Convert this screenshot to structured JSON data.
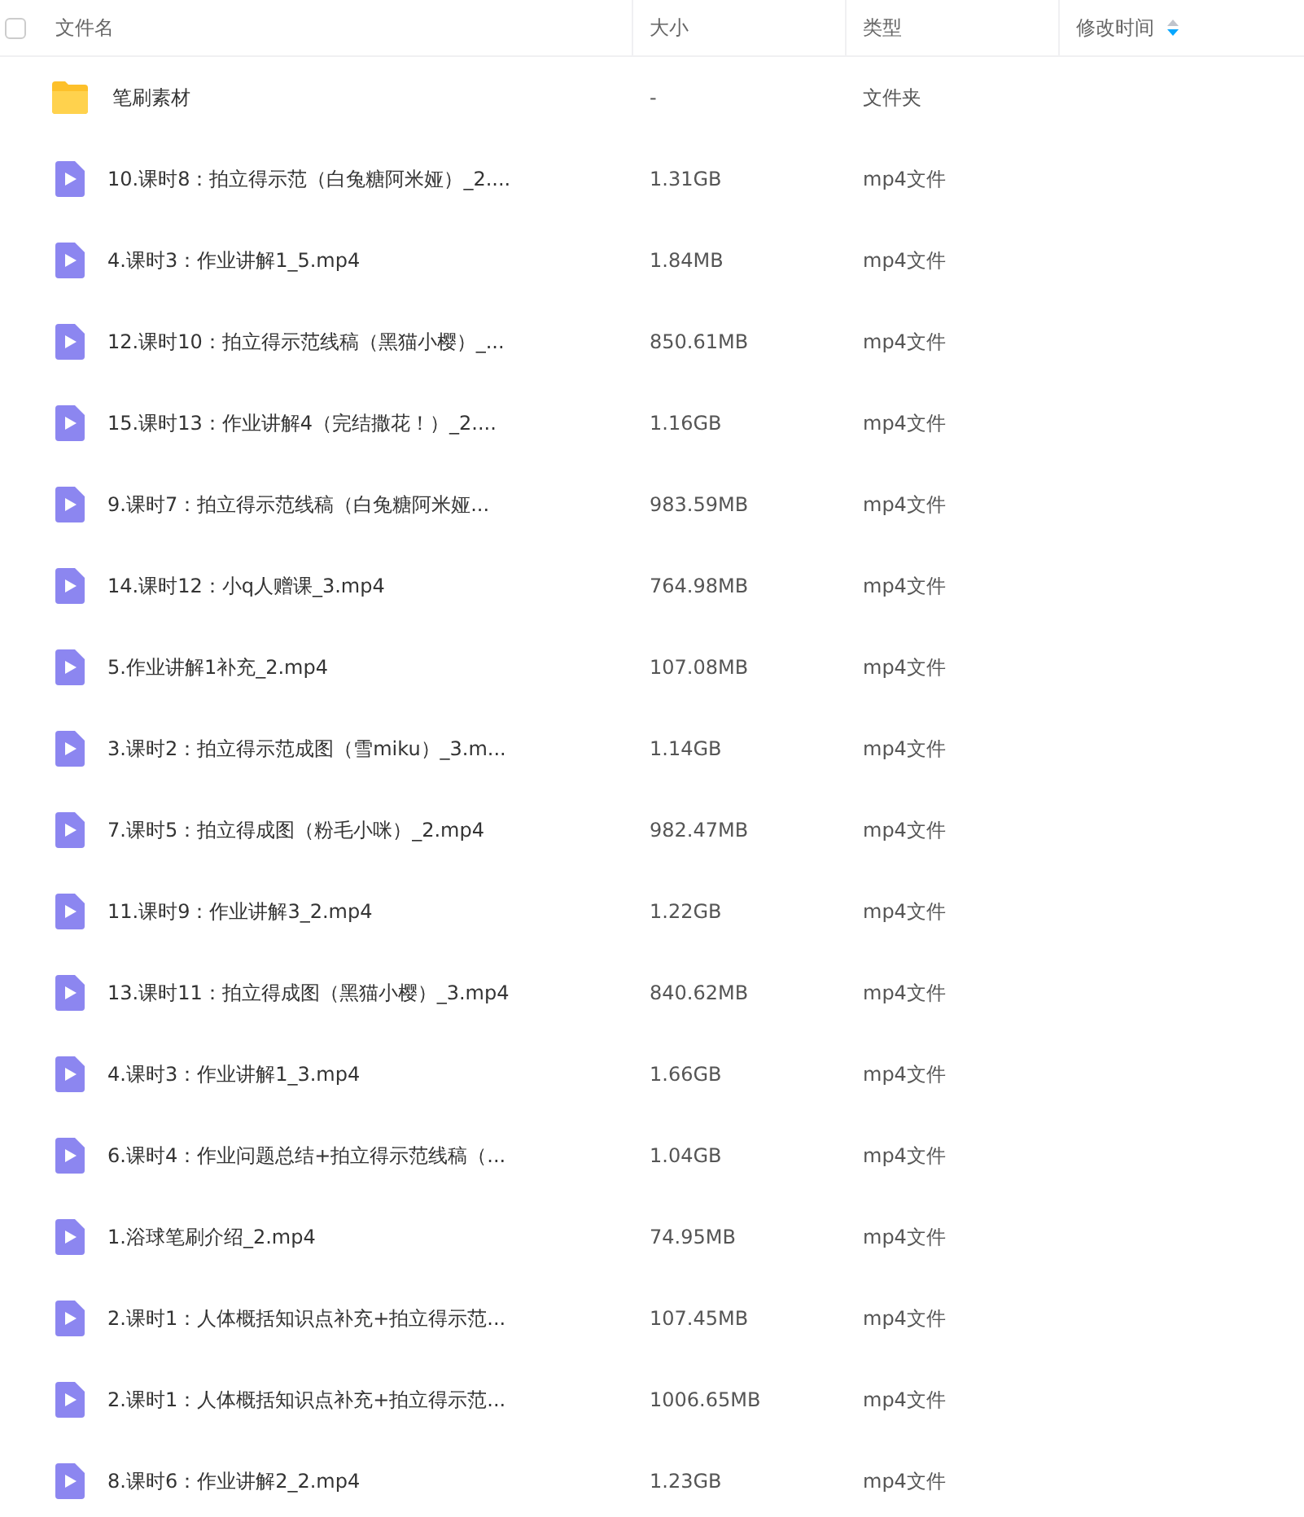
{
  "table": {
    "select_all": {
      "checked": false
    },
    "columns": [
      {
        "label": "文件名"
      },
      {
        "label": "大小"
      },
      {
        "label": "类型"
      },
      {
        "label": "修改时间",
        "sort_descending": true
      }
    ],
    "rows": [
      {
        "kind": "folder",
        "name": "笔刷素材",
        "size": "-",
        "type": "文件夹"
      },
      {
        "kind": "video",
        "name": "10.课时8：拍立得示范（白兔糖阿米娅）_2....",
        "size": "1.31GB",
        "type": "mp4文件"
      },
      {
        "kind": "video",
        "name": "4.课时3：作业讲解1_5.mp4",
        "size": "1.84MB",
        "type": "mp4文件"
      },
      {
        "kind": "video",
        "name": "12.课时10：拍立得示范线稿（黑猫小樱）_...",
        "size": "850.61MB",
        "type": "mp4文件"
      },
      {
        "kind": "video",
        "name": "15.课时13：作业讲解4（完结撒花！）_2....",
        "size": "1.16GB",
        "type": "mp4文件"
      },
      {
        "kind": "video",
        "name": "9.课时7：拍立得示范线稿（白兔糖阿米娅...",
        "size": "983.59MB",
        "type": "mp4文件"
      },
      {
        "kind": "video",
        "name": "14.课时12：小q人赠课_3.mp4",
        "size": "764.98MB",
        "type": "mp4文件"
      },
      {
        "kind": "video",
        "name": "5.作业讲解1补充_2.mp4",
        "size": "107.08MB",
        "type": "mp4文件"
      },
      {
        "kind": "video",
        "name": "3.课时2：拍立得示范成图（雪miku）_3.m...",
        "size": "1.14GB",
        "type": "mp4文件"
      },
      {
        "kind": "video",
        "name": "7.课时5：拍立得成图（粉毛小咪）_2.mp4",
        "size": "982.47MB",
        "type": "mp4文件"
      },
      {
        "kind": "video",
        "name": "11.课时9：作业讲解3_2.mp4",
        "size": "1.22GB",
        "type": "mp4文件"
      },
      {
        "kind": "video",
        "name": "13.课时11：拍立得成图（黑猫小樱）_3.mp4",
        "size": "840.62MB",
        "type": "mp4文件"
      },
      {
        "kind": "video",
        "name": "4.课时3：作业讲解1_3.mp4",
        "size": "1.66GB",
        "type": "mp4文件"
      },
      {
        "kind": "video",
        "name": "6.课时4：作业问题总结+拍立得示范线稿（...",
        "size": "1.04GB",
        "type": "mp4文件"
      },
      {
        "kind": "video",
        "name": "1.浴球笔刷介绍_2.mp4",
        "size": "74.95MB",
        "type": "mp4文件"
      },
      {
        "kind": "video",
        "name": "2.课时1：人体概括知识点补充+拍立得示范...",
        "size": "107.45MB",
        "type": "mp4文件"
      },
      {
        "kind": "video",
        "name": "2.课时1：人体概括知识点补充+拍立得示范...",
        "size": "1006.65MB",
        "type": "mp4文件"
      },
      {
        "kind": "video",
        "name": "8.课时6：作业讲解2_2.mp4",
        "size": "1.23GB",
        "type": "mp4文件"
      }
    ]
  }
}
